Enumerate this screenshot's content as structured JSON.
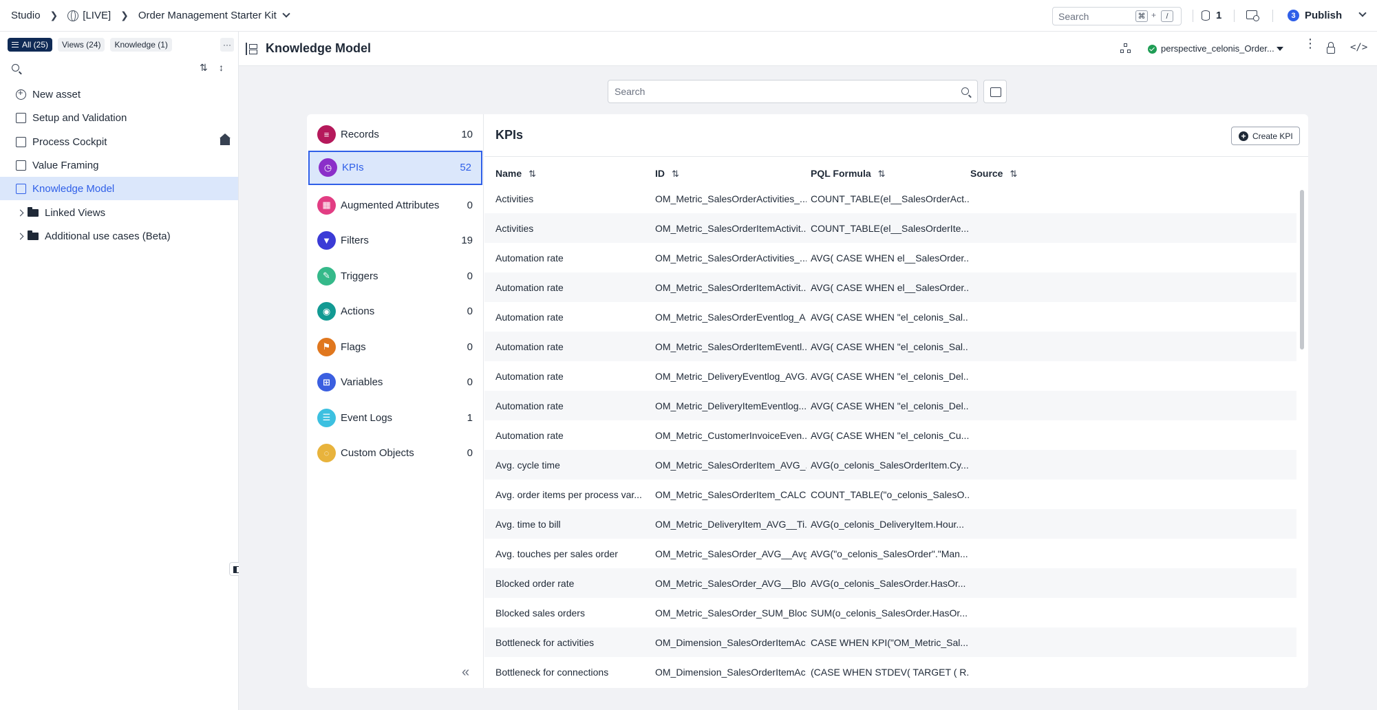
{
  "topbar": {
    "studio": "Studio",
    "space": "[LIVE]",
    "package": "Order Management Starter Kit",
    "search_placeholder": "Search",
    "kbd_cmd": "⌘",
    "kbd_plus": "+",
    "kbd_slash": "/",
    "db_count": "1",
    "publish_badge": "3",
    "publish_label": "Publish"
  },
  "sidebar": {
    "filters": [
      "All (25)",
      "Views (24)",
      "Knowledge (1)"
    ],
    "more": "···",
    "items": [
      {
        "label": "New asset"
      },
      {
        "label": "Setup and Validation"
      },
      {
        "label": "Process Cockpit"
      },
      {
        "label": "Value Framing"
      },
      {
        "label": "Knowledge Model"
      }
    ],
    "folders": [
      {
        "label": "Linked Views"
      },
      {
        "label": "Additional use cases (Beta)"
      }
    ]
  },
  "header": {
    "title": "Knowledge Model",
    "perspective": "perspective_celonis_Order...",
    "kebab": "⋮",
    "code": "</>"
  },
  "search": {
    "placeholder": "Search"
  },
  "categories": [
    {
      "label": "Records",
      "count": "10",
      "color": "#b5195b"
    },
    {
      "label": "KPIs",
      "count": "52",
      "color": "#8b2fc9"
    },
    {
      "label": "Augmented Attributes",
      "count": "0",
      "color": "#e23d83"
    },
    {
      "label": "Filters",
      "count": "19",
      "color": "#3b3bd6"
    },
    {
      "label": "Triggers",
      "count": "0",
      "color": "#35b98a"
    },
    {
      "label": "Actions",
      "count": "0",
      "color": "#129a93"
    },
    {
      "label": "Flags",
      "count": "0",
      "color": "#e0771e"
    },
    {
      "label": "Variables",
      "count": "0",
      "color": "#3b5fe0"
    },
    {
      "label": "Event Logs",
      "count": "1",
      "color": "#3cc0e0"
    },
    {
      "label": "Custom Objects",
      "count": "0",
      "color": "#e8b33c"
    }
  ],
  "kpis": {
    "title": "KPIs",
    "create_label": "Create KPI",
    "columns": [
      "Name",
      "ID",
      "PQL Formula",
      "Source"
    ],
    "rows": [
      [
        "Activities",
        "OM_Metric_SalesOrderActivities_...",
        "COUNT_TABLE(el__SalesOrderAct..."
      ],
      [
        "Activities",
        "OM_Metric_SalesOrderItemActivit...",
        "COUNT_TABLE(el__SalesOrderIte..."
      ],
      [
        "Automation rate",
        "OM_Metric_SalesOrderActivities_...",
        "AVG( CASE WHEN el__SalesOrder..."
      ],
      [
        "Automation rate",
        "OM_Metric_SalesOrderItemActivit...",
        "AVG( CASE WHEN el__SalesOrder..."
      ],
      [
        "Automation rate",
        "OM_Metric_SalesOrderEventlog_A...",
        "AVG( CASE WHEN \"el_celonis_Sal..."
      ],
      [
        "Automation rate",
        "OM_Metric_SalesOrderItemEventl...",
        "AVG( CASE WHEN \"el_celonis_Sal..."
      ],
      [
        "Automation rate",
        "OM_Metric_DeliveryEventlog_AVG...",
        "AVG( CASE WHEN \"el_celonis_Del..."
      ],
      [
        "Automation rate",
        "OM_Metric_DeliveryItemEventlog...",
        "AVG( CASE WHEN \"el_celonis_Del..."
      ],
      [
        "Automation rate",
        "OM_Metric_CustomerInvoiceEven...",
        "AVG( CASE WHEN \"el_celonis_Cu..."
      ],
      [
        "Avg. cycle time",
        "OM_Metric_SalesOrderItem_AVG_...",
        "AVG(o_celonis_SalesOrderItem.Cy..."
      ],
      [
        "Avg. order items per process var...",
        "OM_Metric_SalesOrderItem_CALC...",
        "COUNT_TABLE(\"o_celonis_SalesO..."
      ],
      [
        "Avg. time to bill",
        "OM_Metric_DeliveryItem_AVG__Ti...",
        "AVG(o_celonis_DeliveryItem.Hour..."
      ],
      [
        "Avg. touches per sales order",
        "OM_Metric_SalesOrder_AVG__Avg...",
        "AVG(\"o_celonis_SalesOrder\".\"Man..."
      ],
      [
        "Blocked order rate",
        "OM_Metric_SalesOrder_AVG__Blo...",
        "AVG(o_celonis_SalesOrder.HasOr..."
      ],
      [
        "Blocked sales orders",
        "OM_Metric_SalesOrder_SUM_Bloc...",
        "SUM(o_celonis_SalesOrder.HasOr..."
      ],
      [
        "Bottleneck for activities",
        "OM_Dimension_SalesOrderItemAc...",
        "CASE WHEN KPI(\"OM_Metric_Sal..."
      ],
      [
        "Bottleneck for connections",
        "OM_Dimension_SalesOrderItemAc...",
        "(CASE WHEN STDEV( TARGET ( R..."
      ]
    ]
  }
}
